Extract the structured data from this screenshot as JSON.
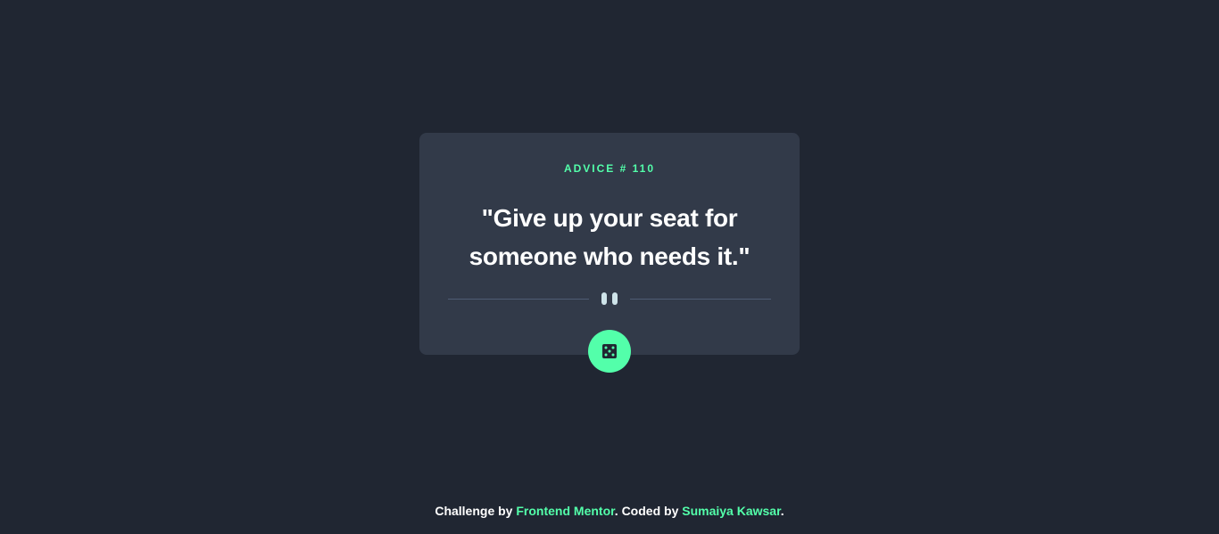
{
  "advice": {
    "label": "ADVICE #",
    "number": "110",
    "quote": "\"Give up your seat for someone who needs it.\""
  },
  "dice_button": {
    "icon": "dice-icon"
  },
  "footer": {
    "prefix": "Challenge by",
    "link1": "Frontend Mentor",
    "middle": ". Coded by",
    "link2": "Sumaiya Kawsar",
    "suffix": "."
  },
  "colors": {
    "background": "#202632",
    "card": "#323A49",
    "accent": "#53FFAA",
    "divider": "#4F5D74",
    "text": "#FFFFFF"
  }
}
